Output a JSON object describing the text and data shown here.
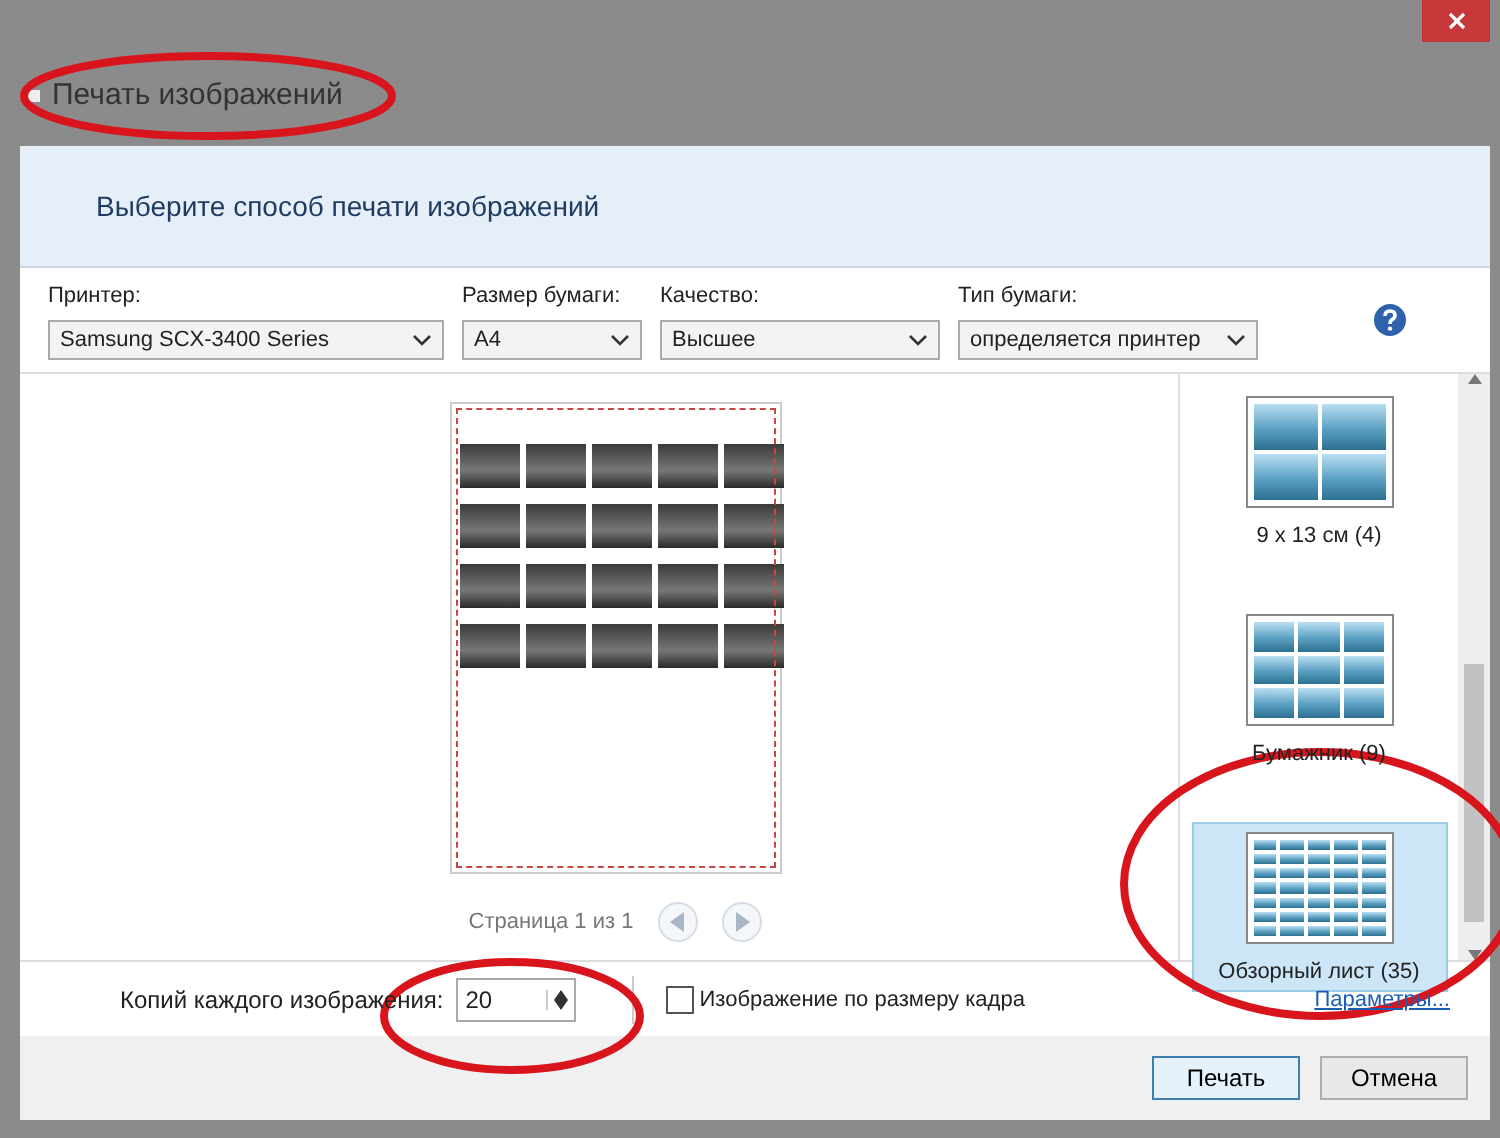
{
  "window": {
    "title": "Печать изображений"
  },
  "heading": "Выберите способ печати изображений",
  "fields": [
    {
      "label": "Принтер:",
      "value": "Samsung SCX-3400 Series"
    },
    {
      "label": "Размер бумаги:",
      "value": "A4"
    },
    {
      "label": "Качество:",
      "value": "Высшее"
    },
    {
      "label": "Тип бумаги:",
      "value": "определяется принтер"
    }
  ],
  "preview": {
    "page_label": "Страница 1 из 1"
  },
  "layouts": [
    {
      "label": "9 x 13 см (4)",
      "kind": "grid2",
      "selected": false
    },
    {
      "label": "Бумажник (9)",
      "kind": "grid3",
      "selected": false
    },
    {
      "label": "Обзорный лист (35)",
      "kind": "sheet",
      "selected": true
    }
  ],
  "copies": {
    "label": "Копий каждого изображения:",
    "value": "20"
  },
  "fit": {
    "label": "Изображение по размеру кадра",
    "checked": false
  },
  "options_link": "Параметры...",
  "buttons": [
    {
      "label": "Печать",
      "default": true
    },
    {
      "label": "Отмена",
      "default": false
    }
  ]
}
